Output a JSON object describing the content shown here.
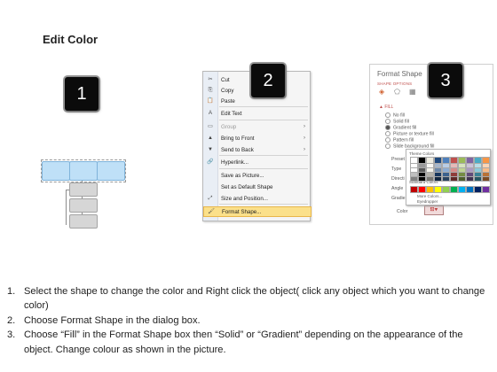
{
  "page": {
    "title": "Edit Color"
  },
  "badges": [
    "1",
    "2",
    "3"
  ],
  "context_menu": {
    "items": [
      {
        "icon": "✂",
        "label": "Cut",
        "arrow": "",
        "state": "normal"
      },
      {
        "icon": "⎘",
        "label": "Copy",
        "arrow": "",
        "state": "normal"
      },
      {
        "icon": "📋",
        "label": "Paste",
        "arrow": "",
        "state": "normal"
      },
      {
        "icon": "A",
        "label": "Edit Text",
        "arrow": "",
        "state": "normal"
      },
      {
        "icon": "▭",
        "label": "Group",
        "arrow": "›",
        "state": "disabled"
      },
      {
        "icon": "▲",
        "label": "Bring to Front",
        "arrow": "›",
        "state": "normal"
      },
      {
        "icon": "▼",
        "label": "Send to Back",
        "arrow": "›",
        "state": "normal"
      },
      {
        "icon": "🔗",
        "label": "Hyperlink...",
        "arrow": "",
        "state": "normal"
      },
      {
        "icon": "",
        "label": "Save as Picture...",
        "arrow": "",
        "state": "normal"
      },
      {
        "icon": "",
        "label": "Set as Default Shape",
        "arrow": "",
        "state": "normal"
      },
      {
        "icon": "⤢",
        "label": "Size and Position...",
        "arrow": "",
        "state": "normal"
      },
      {
        "icon": "🖌",
        "label": "Format Shape...",
        "arrow": "",
        "state": "highlighted"
      }
    ]
  },
  "format_shape": {
    "title": "Format Shape",
    "subtitle": "SHAPE OPTIONS",
    "fill_header": "▲ FILL",
    "fill_options": [
      {
        "label": "No fill",
        "selected": false
      },
      {
        "label": "Solid fill",
        "selected": false
      },
      {
        "label": "Gradient fill",
        "selected": true
      },
      {
        "label": "Picture or texture fill",
        "selected": false
      },
      {
        "label": "Pattern fill",
        "selected": false
      },
      {
        "label": "Slide background fill",
        "selected": false
      }
    ],
    "field_labels": [
      "Preset",
      "Type",
      "Directi",
      "Angle",
      "Gradie"
    ],
    "color_label": "Color",
    "palette": {
      "theme_header": "Theme Colors",
      "standard_header": "Standard Colors",
      "more_colors": "More Colors...",
      "eyedropper": "Eyedropper",
      "theme_top": [
        "#ffffff",
        "#000000",
        "#eeece1",
        "#1f497d",
        "#4f81bd",
        "#c0504d",
        "#9bbb59",
        "#8064a2",
        "#4bacc6",
        "#f79646"
      ],
      "standard": [
        "#c00000",
        "#ff0000",
        "#ffc000",
        "#ffff00",
        "#92d050",
        "#00b050",
        "#00b0f0",
        "#0070c0",
        "#002060",
        "#7030a0"
      ]
    }
  },
  "steps": [
    {
      "num": "1.",
      "text": "Select the shape to change the color and Right click the object( click any object which you want to change color)"
    },
    {
      "num": "2.",
      "text": "Choose Format Shape in the dialog box."
    },
    {
      "num": "3.",
      "text": "Choose “Fill” in the Format Shape box then “Solid” or “Gradient” depending on the appearance of the object. Change colour as shown in the picture."
    }
  ]
}
